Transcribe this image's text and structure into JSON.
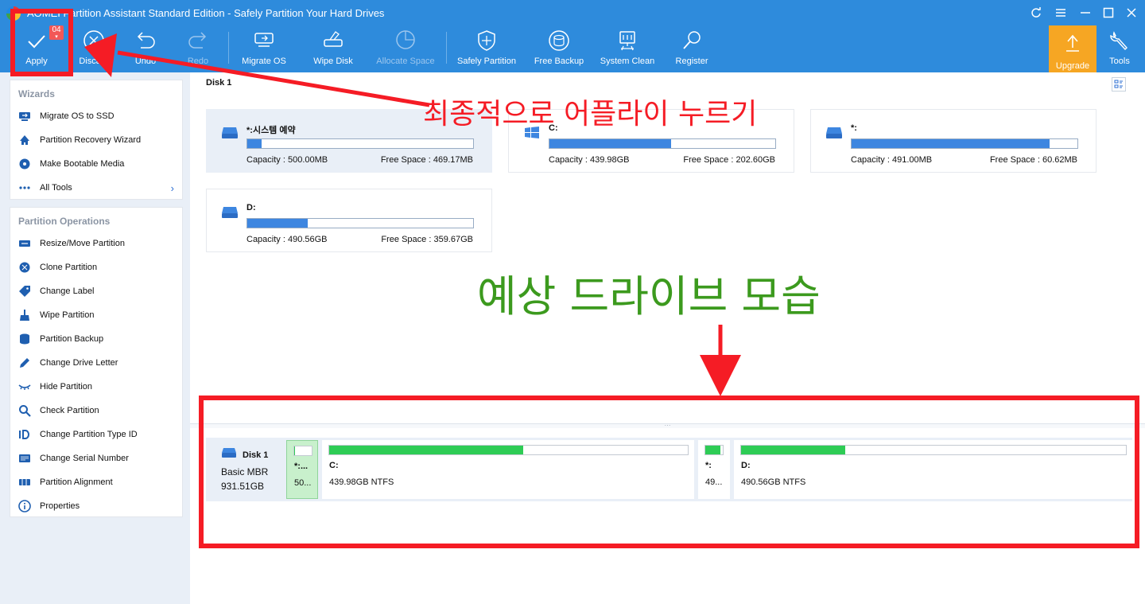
{
  "window": {
    "title": "AOMEI Partition Assistant Standard Edition - Safely Partition Your Hard Drives"
  },
  "toolbar": {
    "apply": {
      "label": "Apply",
      "badge": "04"
    },
    "discard": {
      "label": "Discard"
    },
    "undo": {
      "label": "Undo"
    },
    "redo": {
      "label": "Redo"
    },
    "migrate_os": {
      "label": "Migrate OS"
    },
    "wipe_disk": {
      "label": "Wipe Disk"
    },
    "allocate_space": {
      "label": "Allocate Space"
    },
    "safely_partition": {
      "label": "Safely Partition"
    },
    "free_backup": {
      "label": "Free Backup"
    },
    "system_clean": {
      "label": "System Clean"
    },
    "register": {
      "label": "Register"
    },
    "upgrade": {
      "label": "Upgrade"
    },
    "tools": {
      "label": "Tools"
    }
  },
  "sidebar": {
    "wizards": {
      "title": "Wizards",
      "items": [
        {
          "label": "Migrate OS to SSD",
          "icon": "migrate-icon"
        },
        {
          "label": "Partition Recovery Wizard",
          "icon": "recovery-icon"
        },
        {
          "label": "Make Bootable Media",
          "icon": "bootable-media-icon"
        },
        {
          "label": "All Tools",
          "icon": "dots-icon"
        }
      ]
    },
    "operations": {
      "title": "Partition Operations",
      "items": [
        {
          "label": "Resize/Move Partition",
          "icon": "resize-icon"
        },
        {
          "label": "Clone Partition",
          "icon": "clone-icon"
        },
        {
          "label": "Change Label",
          "icon": "tag-icon"
        },
        {
          "label": "Wipe Partition",
          "icon": "broom-icon"
        },
        {
          "label": "Partition Backup",
          "icon": "backup-icon"
        },
        {
          "label": "Change Drive Letter",
          "icon": "pencil-icon"
        },
        {
          "label": "Hide Partition",
          "icon": "eye-closed-icon"
        },
        {
          "label": "Check Partition",
          "icon": "magnifier-icon"
        },
        {
          "label": "Change Partition Type ID",
          "icon": "id-icon"
        },
        {
          "label": "Change Serial Number",
          "icon": "serial-icon"
        },
        {
          "label": "Partition Alignment",
          "icon": "alignment-icon"
        },
        {
          "label": "Properties",
          "icon": "info-icon"
        }
      ]
    }
  },
  "main": {
    "disk_title": "Disk 1",
    "cards": [
      {
        "name": "*:시스템 예약",
        "capacity": "Capacity : 500.00MB",
        "free": "Free Space : 469.17MB",
        "used_fraction": 0.062,
        "icon": "drive-icon",
        "selected": true
      },
      {
        "name": "C:",
        "capacity": "Capacity : 439.98GB",
        "free": "Free Space : 202.60GB",
        "used_fraction": 0.54,
        "icon": "windows-icon",
        "selected": false
      },
      {
        "name": "*:",
        "capacity": "Capacity : 491.00MB",
        "free": "Free Space : 60.62MB",
        "used_fraction": 0.877,
        "icon": "drive-icon",
        "selected": false
      },
      {
        "name": "D:",
        "capacity": "Capacity : 490.56GB",
        "free": "Free Space : 359.67GB",
        "used_fraction": 0.267,
        "icon": "drive-icon",
        "selected": false
      }
    ],
    "disk_map": {
      "name": "Disk 1",
      "type": "Basic MBR",
      "size": "931.51GB",
      "partitions": [
        {
          "label": "*:...",
          "desc": "50...",
          "used_fraction": 0.06
        },
        {
          "label": "C:",
          "desc": "439.98GB NTFS",
          "used_fraction": 0.54
        },
        {
          "label": "*:",
          "desc": "49...",
          "used_fraction": 0.88
        },
        {
          "label": "D:",
          "desc": "490.56GB NTFS",
          "used_fraction": 0.27
        }
      ]
    }
  },
  "annotations": {
    "apply_note": "최종적으로 어플라이 누르기",
    "expected_note": "예상 드라이브 모습",
    "colors": {
      "red": "#f51c25",
      "green": "#3c9a1e"
    }
  }
}
